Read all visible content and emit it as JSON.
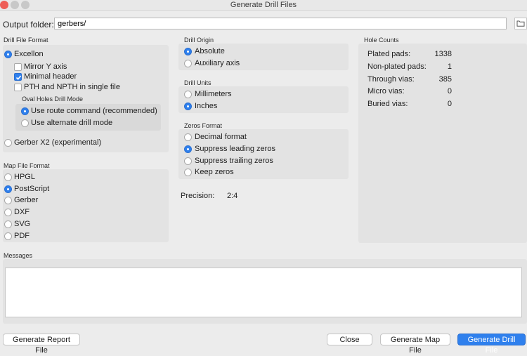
{
  "window": {
    "title": "Generate Drill Files"
  },
  "output": {
    "label": "Output folder:",
    "value": "gerbers/",
    "browse_icon": "folder-icon"
  },
  "drill_format": {
    "label": "Drill File Format",
    "excellon": "Excellon",
    "mirror_y": "Mirror Y axis",
    "minimal_header": "Minimal header",
    "pth_npth": "PTH and NPTH in single file",
    "oval_label": "Oval Holes Drill Mode",
    "oval_route": "Use route command (recommended)",
    "oval_alt": "Use alternate drill mode",
    "gerber_x2": "Gerber X2 (experimental)"
  },
  "map_format": {
    "label": "Map File Format",
    "options": [
      "HPGL",
      "PostScript",
      "Gerber",
      "DXF",
      "SVG",
      "PDF"
    ],
    "selected": "PostScript"
  },
  "drill_origin": {
    "label": "Drill Origin",
    "absolute": "Absolute",
    "auxiliary": "Auxiliary axis",
    "selected": "Absolute"
  },
  "drill_units": {
    "label": "Drill Units",
    "mm": "Millimeters",
    "inches": "Inches",
    "selected": "Inches"
  },
  "zeros_format": {
    "label": "Zeros Format",
    "decimal": "Decimal format",
    "leading": "Suppress leading zeros",
    "trailing": "Suppress trailing zeros",
    "keep": "Keep zeros",
    "selected": "Suppress leading zeros"
  },
  "precision": {
    "label": "Precision:",
    "value": "2:4"
  },
  "hole_counts": {
    "label": "Hole Counts",
    "rows": [
      {
        "label": "Plated pads:",
        "value": "1338"
      },
      {
        "label": "Non-plated pads:",
        "value": "1"
      },
      {
        "label": "Through vias:",
        "value": "385"
      },
      {
        "label": "Micro vias:",
        "value": "0"
      },
      {
        "label": "Buried vias:",
        "value": "0"
      }
    ]
  },
  "messages": {
    "label": "Messages"
  },
  "buttons": {
    "report": "Generate Report File",
    "close": "Close",
    "map": "Generate Map File",
    "drill": "Generate Drill File"
  },
  "colors": {
    "accent": "#2f80ed",
    "window_bg": "#ececec",
    "panel_bg": "#e3e3e3"
  }
}
